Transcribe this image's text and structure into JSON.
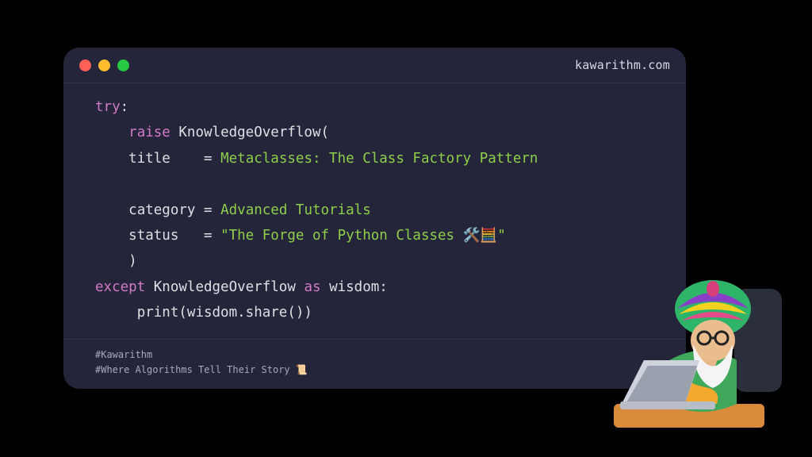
{
  "site": "kawarithm.com",
  "code": {
    "kw_try": "try",
    "kw_raise": "raise",
    "class_name": "KnowledgeOverflow",
    "p_title": "title",
    "v_title": "Metaclasses: The Class Factory Pattern",
    "p_category": "category",
    "v_category": "Advanced Tutorials",
    "p_status": "status",
    "v_status": "\"The Forge of Python Classes 🛠️🧮\"",
    "kw_except": "except",
    "kw_as": "as",
    "var_wisdom": "wisdom",
    "print_line": "print(wisdom.share())"
  },
  "footer": {
    "tag1": "#Kawarithm",
    "tag2": "#Where Algorithms Tell Their Story 📜"
  }
}
